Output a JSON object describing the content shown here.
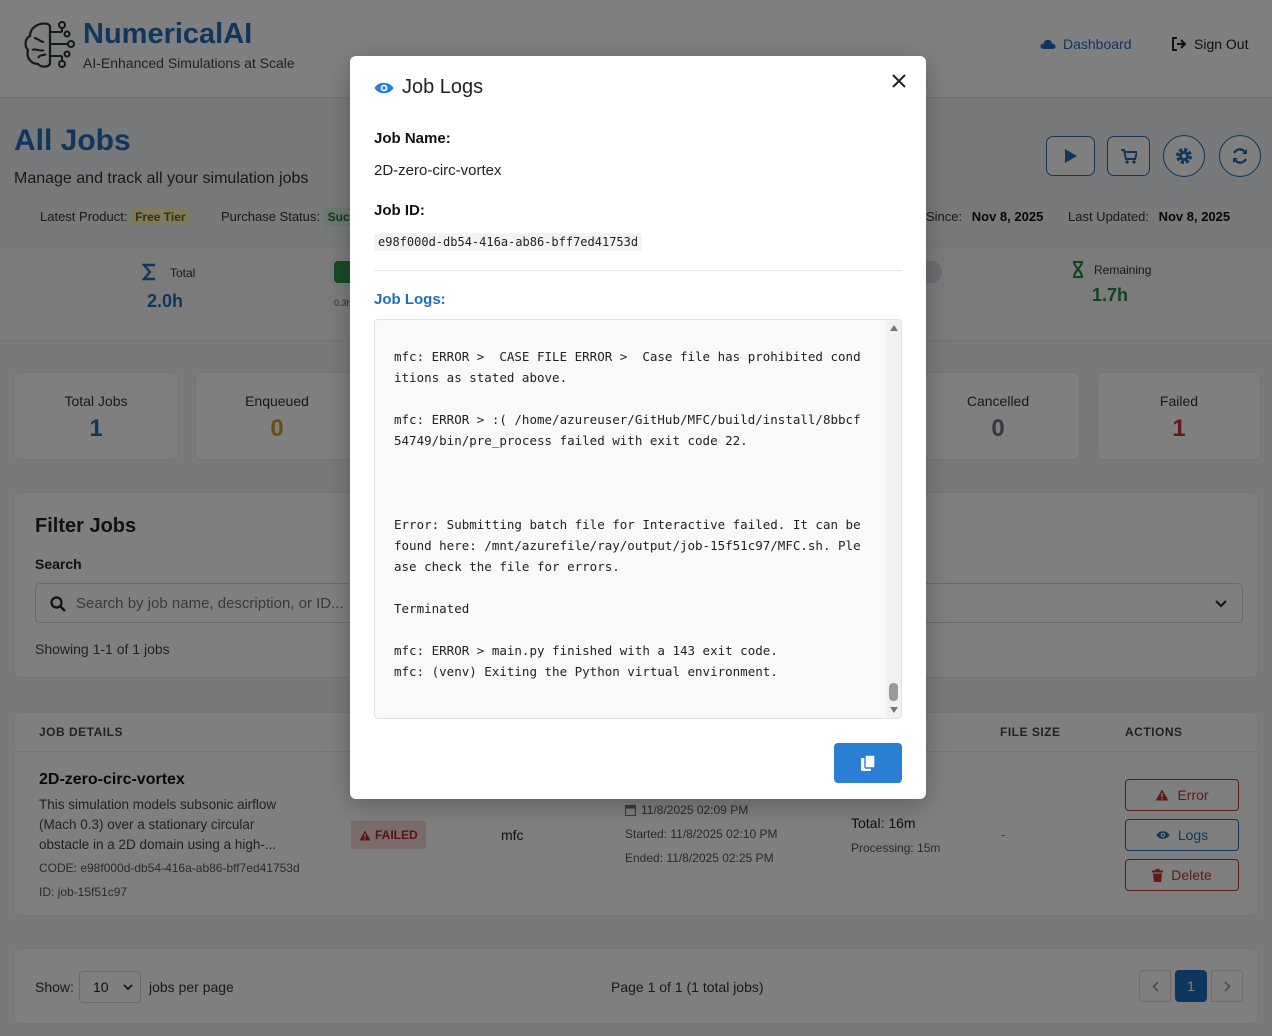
{
  "brand": {
    "name": "NumericalAI",
    "tagline": "AI-Enhanced Simulations at Scale"
  },
  "nav": {
    "dashboard": "Dashboard",
    "sign_out": "Sign Out"
  },
  "page": {
    "title": "All Jobs",
    "subtitle": "Manage and track all your simulation jobs"
  },
  "meta": {
    "latest_product_label": "Latest Product:",
    "latest_product_value": "Free Tier",
    "purchase_status_label": "Purchase Status:",
    "purchase_status_value": "Suc",
    "since_label": "Since:",
    "since_value": "Nov 8, 2025",
    "updated_label": "Last Updated:",
    "updated_value": "Nov 8, 2025"
  },
  "usage": {
    "total_label": "Total",
    "total_value": "2.0h",
    "small_text": "0.3h",
    "remaining_label": "Remaining",
    "remaining_value": "1.7h"
  },
  "stats": [
    {
      "label": "Total Jobs",
      "value": "1",
      "color": "#1e6fba"
    },
    {
      "label": "Enqueued",
      "value": "0",
      "color": "#d49a1a"
    },
    {
      "label": "Cancelled",
      "value": "0",
      "color": "#6b7380"
    },
    {
      "label": "Failed",
      "value": "1",
      "color": "#c83232"
    }
  ],
  "filter": {
    "title": "Filter Jobs",
    "search_label": "Search",
    "search_placeholder": "Search by job name, description, or ID...",
    "showing": "Showing 1-1 of 1 jobs"
  },
  "table": {
    "headers": {
      "details": "JOB DETAILS",
      "file_size": "FILE SIZE",
      "actions": "ACTIONS"
    },
    "row": {
      "name": "2D-zero-circ-vortex",
      "description": "This simulation models subsonic airflow (Mach 0.3) over a stationary circular obstacle in a 2D domain using a high-...",
      "code": "CODE: e98f000d-db54-416a-ab86-bff7ed41753d",
      "id": "ID: job-15f51c97",
      "status": "FAILED",
      "app": "mfc",
      "created": "11/8/2025 02:09 PM",
      "started": "Started: 11/8/2025 02:10 PM",
      "ended": "Ended: 11/8/2025 02:25 PM",
      "total": "Total: 16m",
      "processing": "Processing: 15m",
      "size": "-",
      "actions": {
        "error": "Error",
        "logs": "Logs",
        "delete": "Delete"
      }
    }
  },
  "pager": {
    "show": "Show:",
    "per_page": "10",
    "jobs_per_page": "jobs per page",
    "info": "Page 1 of 1 (1 total jobs)",
    "current": "1"
  },
  "modal": {
    "title": "Job Logs",
    "job_name_label": "Job Name:",
    "job_name": "2D-zero-circ-vortex",
    "job_id_label": "Job ID:",
    "job_id": "e98f000d-db54-416a-ab86-bff7ed41753d",
    "logs_label": "Job Logs:",
    "logs": "mfc: ERROR >  CASE FILE ERROR >  Case file has prohibited conditions as stated above.\n\nmfc: ERROR > :( /home/azureuser/GitHub/MFC/build/install/8bbcf54749/bin/pre_process failed with exit code 22.\n\n\n\nError: Submitting batch file for Interactive failed. It can be found here: /mnt/azurefile/ray/output/job-15f51c97/MFC.sh. Please check the file for errors.\n\nTerminated\n\nmfc: ERROR > main.py finished with a 143 exit code.\nmfc: (venv) Exiting the Python virtual environment."
  },
  "colors": {
    "brand": "#1e6fba",
    "success": "#1f8a3a",
    "danger": "#c83232"
  }
}
